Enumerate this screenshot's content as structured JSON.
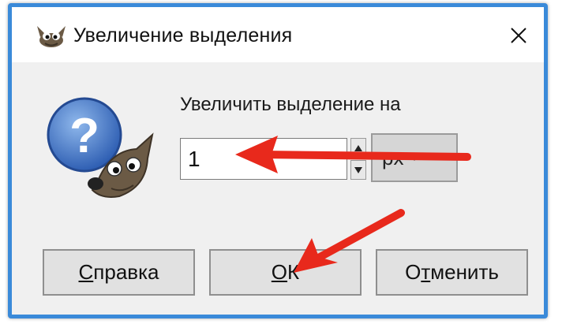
{
  "window": {
    "title": "Увеличение выделения",
    "app_icon": "gimp-wilber-icon",
    "close_icon": "close-icon",
    "accent_color": "#3a8ad9"
  },
  "dialog": {
    "icon": "question-help-icon",
    "prompt": "Увеличить выделение на",
    "grow_input": {
      "value": "1"
    },
    "unit_select": {
      "value": "px"
    }
  },
  "buttons": {
    "help": {
      "mnemonic": "С",
      "rest": "правка"
    },
    "ok": {
      "mnemonic": "О",
      "rest": "К"
    },
    "cancel": {
      "pre": "О",
      "mnemonic": "т",
      "rest": "менить"
    }
  },
  "annotations": {
    "arrow_color": "#e8291c",
    "arrows": [
      "arrow-to-value-input",
      "arrow-to-ok-button"
    ]
  }
}
